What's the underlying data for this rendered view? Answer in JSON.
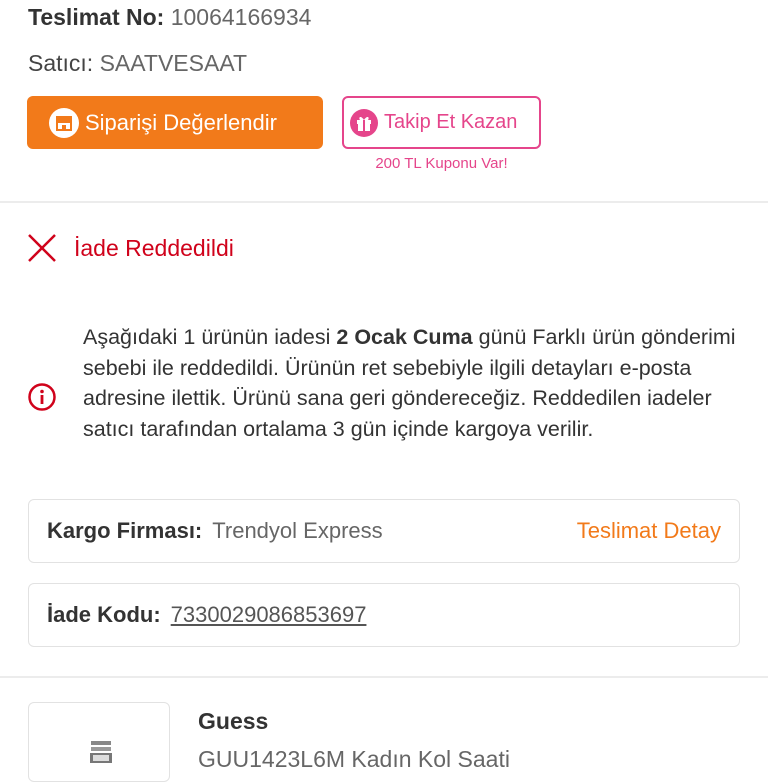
{
  "delivery": {
    "label": "Teslimat No:",
    "value": "10064166934"
  },
  "seller": {
    "label": "Satıcı:",
    "value": "SAATVESAAT"
  },
  "buttons": {
    "review_label": "Siparişi Değerlendir",
    "follow_label": "Takip Et Kazan",
    "coupon_text": "200 TL Kuponu Var!"
  },
  "return": {
    "status": "İade Reddedildi",
    "message_part1": "Aşağıdaki 1 ürünün iadesi ",
    "message_bold": "2 Ocak Cuma",
    "message_part2": " günü Farklı ürün gönderimi sebebi ile reddedildi. Ürünün ret sebebiyle ilgili detayları e-posta adresine ilettik. Ürünü sana geri göndereceğiz. Reddedilen iadeler satıcı tarafından ortalama 3 gün içinde kargoya verilir."
  },
  "shipping": {
    "label": "Kargo Firması:",
    "value": "Trendyol Express",
    "detail_link": "Teslimat Detay"
  },
  "return_code": {
    "label": "İade Kodu:",
    "value": "7330029086853697"
  },
  "product": {
    "brand": "Guess",
    "name": "GUU1423L6M Kadın Kol Saati"
  },
  "colors": {
    "orange": "#f27a1a",
    "pink": "#e5458b",
    "red": "#d0021b"
  },
  "icons": {
    "review": "store-icon",
    "follow": "gift-icon",
    "status": "close-x-icon",
    "message": "info-circle-icon"
  }
}
